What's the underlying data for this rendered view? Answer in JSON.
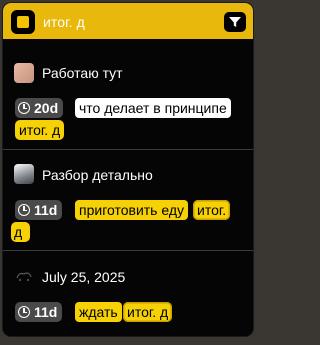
{
  "header": {
    "title": "итог. д",
    "filter_icon": "filter-funnel-icon"
  },
  "items": [
    {
      "title": "Работаю тут",
      "avatar_icon": "avatar-photo",
      "timer": "20d",
      "task_text": "что делает в принципе",
      "tag": "итог. д"
    },
    {
      "title": "Разбор детально",
      "avatar_icon": "avatar-photo",
      "timer": "11d",
      "task_text": "приготовить еду",
      "tag_part1": "итог.",
      "tag_part2": "д"
    },
    {
      "title": "July 25, 2025",
      "avatar_icon": "avatar-photo",
      "timer": "11d",
      "task_text": "ждать",
      "tag": "итог. д"
    }
  ],
  "colors": {
    "accent": "#e8b80c",
    "tag_yellow": "#f5d106",
    "panel_bg": "#050505",
    "timer_bg": "#4a4a4a"
  }
}
